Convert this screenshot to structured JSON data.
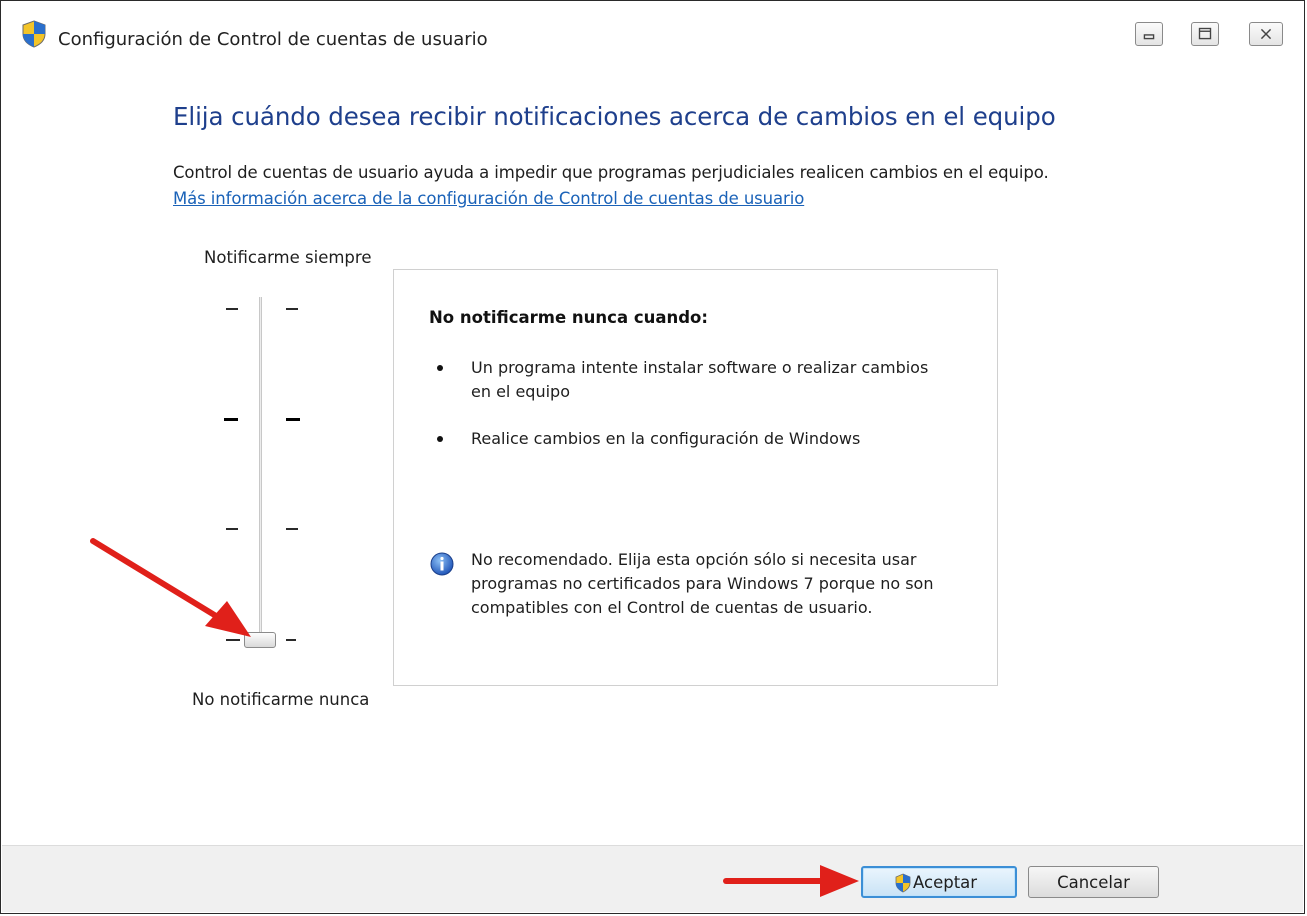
{
  "window": {
    "title": "Configuración de Control de cuentas de usuario",
    "title_icon": "uac-shield-icon",
    "controls": [
      "minimize-icon",
      "maximize-icon",
      "close-icon"
    ]
  },
  "main": {
    "heading": "Elija cuándo desea recibir notificaciones acerca de cambios en el equipo",
    "description": "Control de cuentas de usuario ayuda a impedir que programas perjudiciales realicen cambios en el equipo.",
    "link": "Más información acerca de la configuración de Control de cuentas de usuario"
  },
  "slider": {
    "label_top": "Notificarme siempre",
    "label_bottom": "No notificarme nunca",
    "levels": 4,
    "selected_level": 1
  },
  "panel": {
    "title": "No notificarme nunca cuando:",
    "bullets": [
      "Un programa intente instalar software o realizar cambios en el equipo",
      "Realice cambios en la configuración de Windows"
    ],
    "info": "No recomendado. Elija esta opción sólo si necesita usar programas no certificados para Windows 7 porque no son compatibles con el Control de cuentas de usuario.",
    "info_icon": "info-icon"
  },
  "footer": {
    "accept": "Aceptar",
    "cancel": "Cancelar"
  },
  "colors": {
    "heading": "#1e3f8c",
    "link": "#1a62b8",
    "annotation_arrow": "#e0201a",
    "accept_border": "#3c8fd6"
  }
}
